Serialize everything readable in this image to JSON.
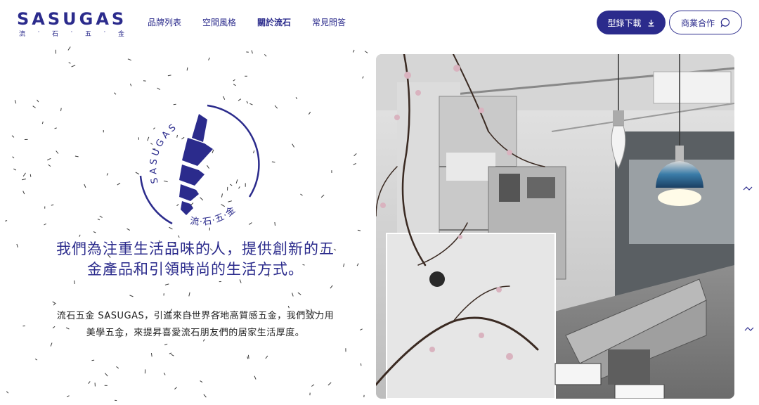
{
  "brand": {
    "name": "SASUGAS",
    "subtitle_chars": [
      "流",
      "·",
      "石",
      "·",
      "五",
      "·",
      "金"
    ],
    "emblem_ring_text": "SASUGAS",
    "emblem_sub_text": "流·石·五·金",
    "color": "#2b2b8c"
  },
  "nav": {
    "items": [
      {
        "label": "品牌列表",
        "active": false
      },
      {
        "label": "空間風格",
        "active": false
      },
      {
        "label": "關於流石",
        "active": true
      },
      {
        "label": "常見問答",
        "active": false
      }
    ]
  },
  "header_buttons": {
    "catalog_label": "型錄下載",
    "catalog_icon": "download-icon",
    "business_label": "商業合作",
    "business_icon": "chat-bubble-icon"
  },
  "hero": {
    "headline": "我們為注重生活品味的人，提供創新的五金產品和引領時尚的生活方式。",
    "description": "流石五金 SASUGAS，引進來自世界各地高質感五金，我們致力用美學五金，來提昇喜愛流石朋友們的居家生活厚度。",
    "photo_alt": "showroom-photo"
  }
}
